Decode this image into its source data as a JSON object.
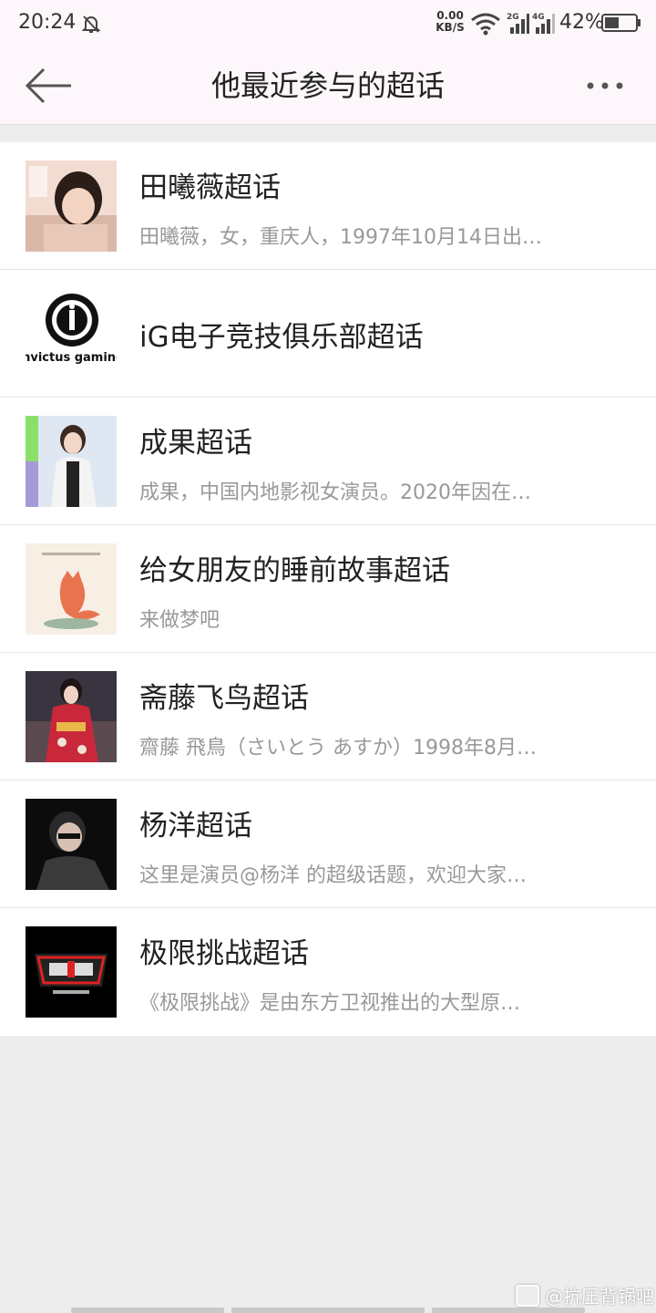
{
  "status_bar": {
    "time": "20:24",
    "net_speed_value": "0.00",
    "net_speed_unit": "KB/S",
    "sig1_label": "2G",
    "sig2_label": "4G",
    "battery": "42%"
  },
  "toolbar": {
    "title": "他最近参与的超话"
  },
  "items": [
    {
      "title": "田曦薇超话",
      "desc": "田曦薇，女，重庆人，1997年10月14日出…",
      "thumb_icon": "portrait-photo"
    },
    {
      "title": "iG电子竞技俱乐部超话",
      "desc": "",
      "thumb_icon": "invictus-gaming-logo",
      "logo_text": "invictus gaming"
    },
    {
      "title": "成果超话",
      "desc": "成果，中国内地影视女演员。2020年因在…",
      "thumb_icon": "portrait-photo"
    },
    {
      "title": "给女朋友的睡前故事超话",
      "desc": "来做梦吧",
      "thumb_icon": "fox-illustration"
    },
    {
      "title": "斋藤飞鸟超话",
      "desc": "齋藤 飛鳥（さいとう あすか）1998年8月…",
      "thumb_icon": "kimono-photo"
    },
    {
      "title": "杨洋超话",
      "desc": "这里是演员@杨洋 的超级话题，欢迎大家…",
      "thumb_icon": "portrait-photo"
    },
    {
      "title": "极限挑战超话",
      "desc": "《极限挑战》是由东方卫视推出的大型原…",
      "thumb_icon": "show-logo"
    }
  ],
  "watermark": "@抗压背锅吧",
  "colors": {
    "header_bg": "#fdf7fb",
    "page_bg": "#ededed",
    "title_text": "#222222",
    "desc_text": "#999999"
  }
}
